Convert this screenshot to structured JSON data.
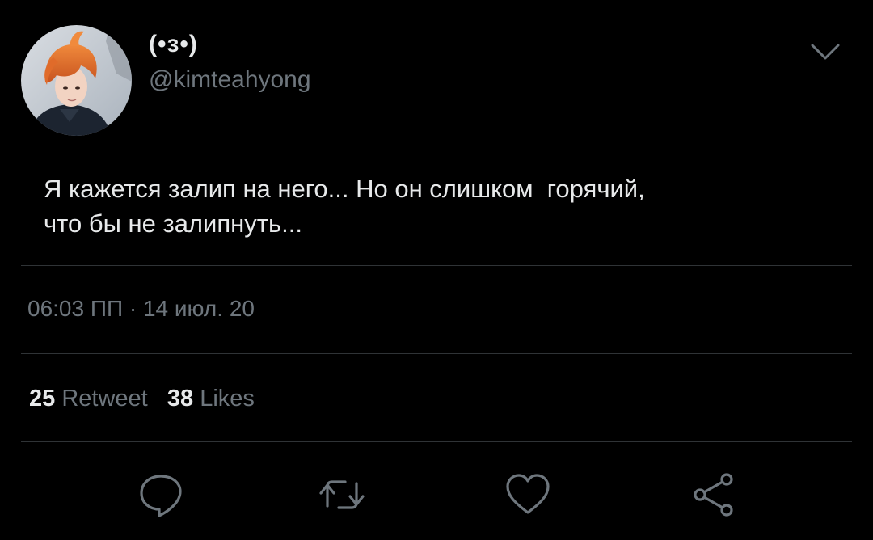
{
  "tweet": {
    "display_name": "(•з•)",
    "handle": "@kimteahyong",
    "text": "Я кажется залип на него... Но он слишком  горячий,\nчто бы не залипнуть...",
    "timestamp": "06:03 ПП · 14 июл. 20"
  },
  "stats": {
    "retweets_count": "25",
    "retweets_label": "Retweet",
    "likes_count": "38",
    "likes_label": "Likes"
  },
  "icons": {
    "more": "chevron-down-icon",
    "reply": "reply-icon",
    "retweet": "retweet-icon",
    "like": "heart-icon",
    "share": "share-icon"
  },
  "colors": {
    "background": "#000000",
    "text_primary": "#e7e9ea",
    "text_secondary": "#6e767d",
    "divider": "#2f3336"
  }
}
